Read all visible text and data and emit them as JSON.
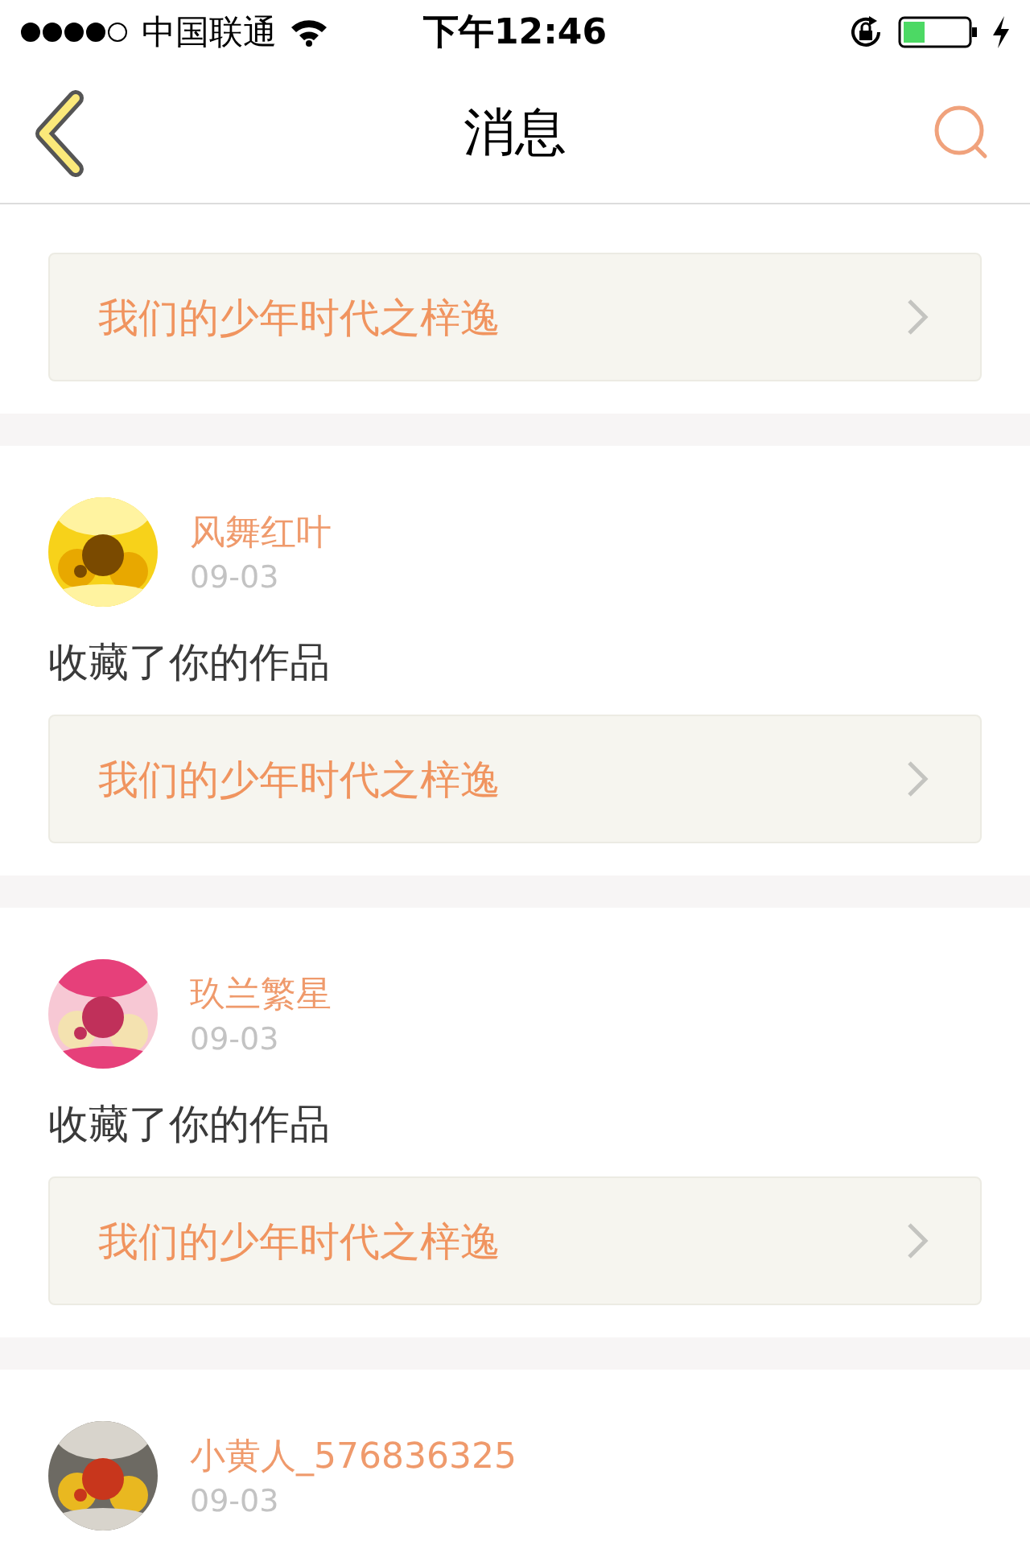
{
  "status_bar": {
    "carrier": "中国联通",
    "time": "下午12:46"
  },
  "header": {
    "title": "消息"
  },
  "messages": [
    {
      "work": "我们的少年时代之梓逸"
    },
    {
      "user": "风舞红叶",
      "date": "09-03",
      "action": "收藏了你的作品",
      "work": "我们的少年时代之梓逸"
    },
    {
      "user": "玖兰繁星",
      "date": "09-03",
      "action": "收藏了你的作品",
      "work": "我们的少年时代之梓逸"
    },
    {
      "user": "小黄人_576836325",
      "date": "09-03"
    }
  ]
}
